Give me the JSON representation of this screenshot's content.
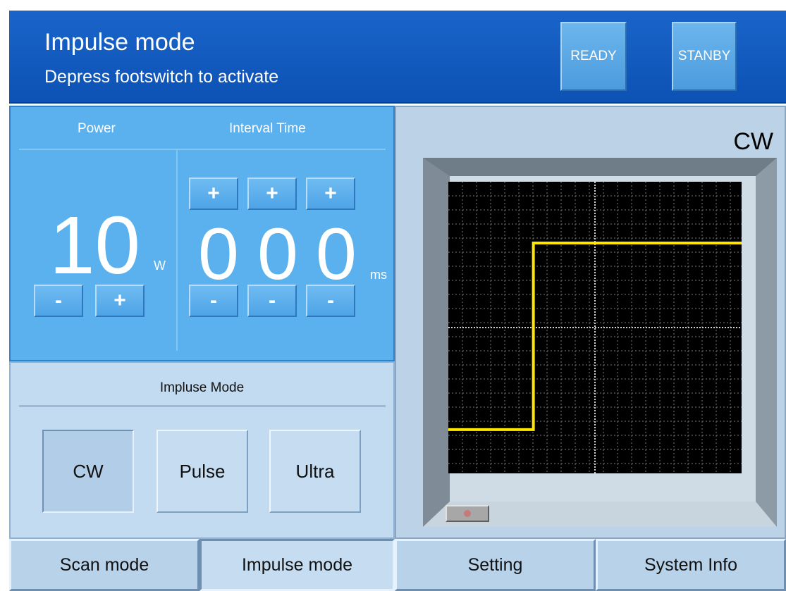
{
  "header": {
    "title": "Impulse mode",
    "subtitle": "Depress footswitch to activate",
    "ready_label": "READY",
    "standby_label": "STANBY"
  },
  "controls": {
    "power_label": "Power",
    "interval_label": "Interval Time",
    "power_value": "10",
    "power_unit": "W",
    "interval_digits": [
      "0",
      "0",
      "0"
    ],
    "interval_unit": "ms",
    "plus": "+",
    "minus": "-"
  },
  "mode_panel": {
    "title": "Impluse Mode",
    "options": [
      "CW",
      "Pulse",
      "Ultra"
    ],
    "selected": "CW"
  },
  "scope": {
    "mode_label": "CW",
    "trace_color": "#ffe600",
    "waveform": {
      "type": "step",
      "low_level": 0.15,
      "high_level": 0.79,
      "step_at": 0.29
    }
  },
  "nav": {
    "scan_mode": "Scan mode",
    "impulse_mode": "Impulse mode",
    "setting": "Setting",
    "system_info": "System Info",
    "active": "Impulse mode"
  },
  "colors": {
    "header_blue": "#1a64c9",
    "panel_blue": "#5ab1ee",
    "panel_light": "#c3dbf1",
    "scope_bg": "#000000"
  }
}
